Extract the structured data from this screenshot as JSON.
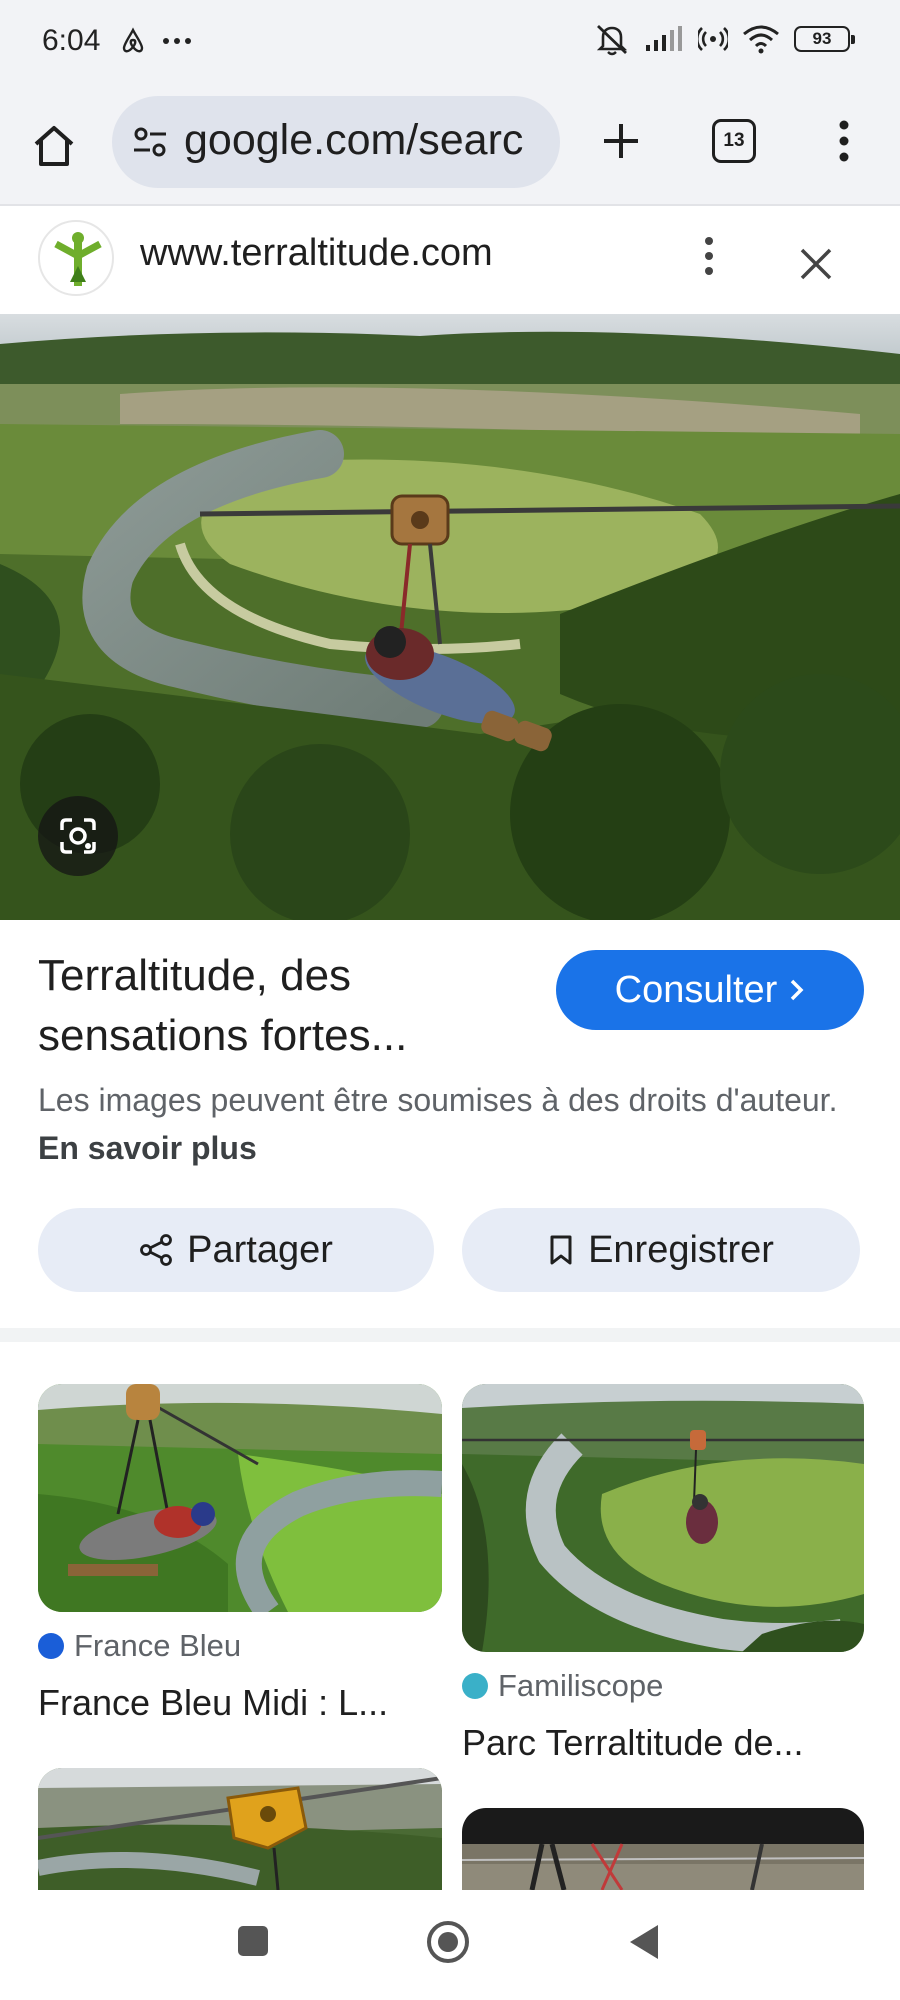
{
  "status_bar": {
    "time": "6:04",
    "left_icons": [
      "airbnb-icon",
      "more-dots-icon"
    ],
    "right_icons": [
      "mute-icon",
      "signal-icon",
      "hotspot-icon",
      "wifi-icon"
    ],
    "battery": "93"
  },
  "browser": {
    "url": "google.com/searc",
    "tab_count": "13"
  },
  "site": {
    "url": "www.terraltitude.com"
  },
  "result": {
    "title": "Terraltitude, des sensations fortes...",
    "consult_label": "Consulter",
    "copyright_text": "Les images peuvent être soumises à des droits d'auteur.",
    "learn_more": "En savoir plus",
    "share_label": "Partager",
    "save_label": "Enregistrer"
  },
  "related": [
    {
      "source": "France Bleu",
      "title": "France Bleu Midi : L...",
      "dot_color": "#1a5ed8"
    },
    {
      "source": "Familiscope",
      "title": "Parc Terraltitude de...",
      "dot_color": "#3ab0c8"
    }
  ],
  "colors": {
    "accent": "#1a73e8",
    "toolbar_bg": "#f2f3f6",
    "pill_bg": "#e7ecf6"
  }
}
